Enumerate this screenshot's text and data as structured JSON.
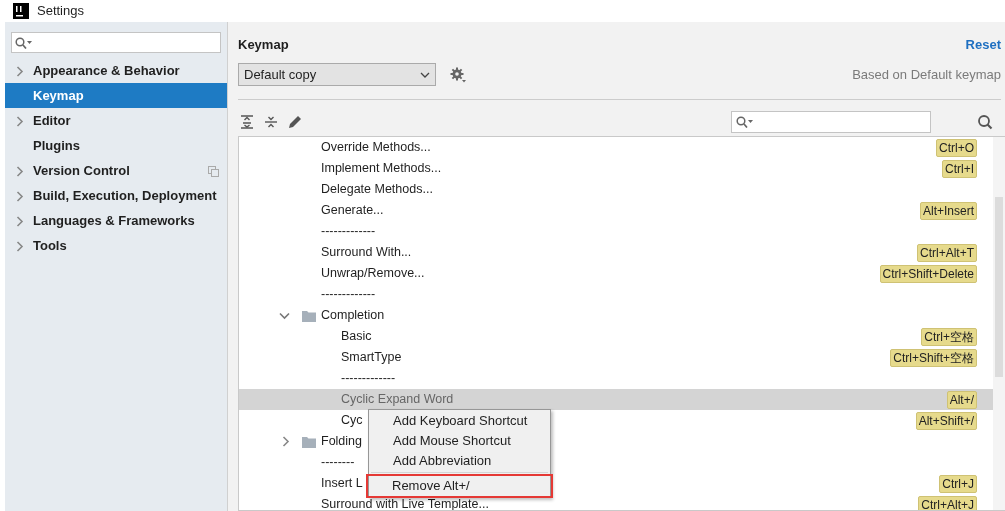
{
  "window": {
    "title": "Settings"
  },
  "sidebar": {
    "items": [
      {
        "label": "Appearance & Behavior",
        "expandable": true,
        "selected": false,
        "project_scope": false
      },
      {
        "label": "Keymap",
        "expandable": false,
        "selected": true,
        "project_scope": false
      },
      {
        "label": "Editor",
        "expandable": true,
        "selected": false,
        "project_scope": false
      },
      {
        "label": "Plugins",
        "expandable": false,
        "selected": false,
        "project_scope": false
      },
      {
        "label": "Version Control",
        "expandable": true,
        "selected": false,
        "project_scope": true
      },
      {
        "label": "Build, Execution, Deployment",
        "expandable": true,
        "selected": false,
        "project_scope": false
      },
      {
        "label": "Languages & Frameworks",
        "expandable": true,
        "selected": false,
        "project_scope": false
      },
      {
        "label": "Tools",
        "expandable": true,
        "selected": false,
        "project_scope": false
      }
    ]
  },
  "header": {
    "title": "Keymap",
    "reset": "Reset",
    "keymap": "Default copy",
    "based_on": "Based on Default keymap"
  },
  "tree": [
    {
      "label": "Override Methods...",
      "shortcut": "Ctrl+O",
      "selected": false
    },
    {
      "label": "Implement Methods...",
      "shortcut": "Ctrl+I",
      "selected": false
    },
    {
      "label": "Delegate Methods...",
      "selected": false
    },
    {
      "label": "Generate...",
      "shortcut": "Alt+Insert",
      "selected": false
    },
    {
      "label": "-------------",
      "selected": false
    },
    {
      "label": "Surround With...",
      "shortcut": "Ctrl+Alt+T",
      "selected": false
    },
    {
      "label": "Unwrap/Remove...",
      "shortcut": "Ctrl+Shift+Delete",
      "selected": false
    },
    {
      "label": "-------------",
      "selected": false
    },
    {
      "label": "Completion",
      "expanded": true,
      "selected": false,
      "children": [
        {
          "label": "Basic",
          "shortcut": "Ctrl+空格",
          "selected": false
        },
        {
          "label": "SmartType",
          "shortcut": "Ctrl+Shift+空格",
          "selected": false
        },
        {
          "label": "-------------",
          "selected": false
        },
        {
          "label": "Cyclic Expand Word",
          "shortcut": "Alt+/",
          "selected": true
        },
        {
          "label": "Cyc",
          "shortcut": "Alt+Shift+/",
          "selected": false
        }
      ]
    },
    {
      "label": "Folding",
      "expanded": false,
      "selected": false
    },
    {
      "label": "--------",
      "selected": false
    },
    {
      "label": "Insert L",
      "shortcut": "Ctrl+J",
      "selected": false
    },
    {
      "label": "Surround with Live Template...",
      "shortcut": "Ctrl+Alt+J",
      "selected": false
    }
  ],
  "context_menu": [
    {
      "label": "Add Keyboard Shortcut",
      "highlighted": false
    },
    {
      "label": "Add Mouse Shortcut",
      "highlighted": false
    },
    {
      "label": "Add Abbreviation",
      "highlighted": false
    },
    {
      "label": "Remove Alt+/",
      "highlighted": true
    }
  ]
}
